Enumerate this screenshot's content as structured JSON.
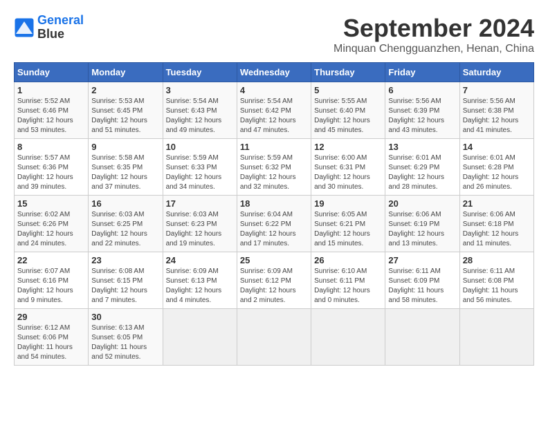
{
  "logo": {
    "line1": "General",
    "line2": "Blue"
  },
  "title": "September 2024",
  "location": "Minquan Chengguanzhen, Henan, China",
  "weekdays": [
    "Sunday",
    "Monday",
    "Tuesday",
    "Wednesday",
    "Thursday",
    "Friday",
    "Saturday"
  ],
  "weeks": [
    [
      {
        "day": "1",
        "sunrise": "5:52 AM",
        "sunset": "6:46 PM",
        "daylight": "12 hours and 53 minutes."
      },
      {
        "day": "2",
        "sunrise": "5:53 AM",
        "sunset": "6:45 PM",
        "daylight": "12 hours and 51 minutes."
      },
      {
        "day": "3",
        "sunrise": "5:54 AM",
        "sunset": "6:43 PM",
        "daylight": "12 hours and 49 minutes."
      },
      {
        "day": "4",
        "sunrise": "5:54 AM",
        "sunset": "6:42 PM",
        "daylight": "12 hours and 47 minutes."
      },
      {
        "day": "5",
        "sunrise": "5:55 AM",
        "sunset": "6:40 PM",
        "daylight": "12 hours and 45 minutes."
      },
      {
        "day": "6",
        "sunrise": "5:56 AM",
        "sunset": "6:39 PM",
        "daylight": "12 hours and 43 minutes."
      },
      {
        "day": "7",
        "sunrise": "5:56 AM",
        "sunset": "6:38 PM",
        "daylight": "12 hours and 41 minutes."
      }
    ],
    [
      {
        "day": "8",
        "sunrise": "5:57 AM",
        "sunset": "6:36 PM",
        "daylight": "12 hours and 39 minutes."
      },
      {
        "day": "9",
        "sunrise": "5:58 AM",
        "sunset": "6:35 PM",
        "daylight": "12 hours and 37 minutes."
      },
      {
        "day": "10",
        "sunrise": "5:59 AM",
        "sunset": "6:33 PM",
        "daylight": "12 hours and 34 minutes."
      },
      {
        "day": "11",
        "sunrise": "5:59 AM",
        "sunset": "6:32 PM",
        "daylight": "12 hours and 32 minutes."
      },
      {
        "day": "12",
        "sunrise": "6:00 AM",
        "sunset": "6:31 PM",
        "daylight": "12 hours and 30 minutes."
      },
      {
        "day": "13",
        "sunrise": "6:01 AM",
        "sunset": "6:29 PM",
        "daylight": "12 hours and 28 minutes."
      },
      {
        "day": "14",
        "sunrise": "6:01 AM",
        "sunset": "6:28 PM",
        "daylight": "12 hours and 26 minutes."
      }
    ],
    [
      {
        "day": "15",
        "sunrise": "6:02 AM",
        "sunset": "6:26 PM",
        "daylight": "12 hours and 24 minutes."
      },
      {
        "day": "16",
        "sunrise": "6:03 AM",
        "sunset": "6:25 PM",
        "daylight": "12 hours and 22 minutes."
      },
      {
        "day": "17",
        "sunrise": "6:03 AM",
        "sunset": "6:23 PM",
        "daylight": "12 hours and 19 minutes."
      },
      {
        "day": "18",
        "sunrise": "6:04 AM",
        "sunset": "6:22 PM",
        "daylight": "12 hours and 17 minutes."
      },
      {
        "day": "19",
        "sunrise": "6:05 AM",
        "sunset": "6:21 PM",
        "daylight": "12 hours and 15 minutes."
      },
      {
        "day": "20",
        "sunrise": "6:06 AM",
        "sunset": "6:19 PM",
        "daylight": "12 hours and 13 minutes."
      },
      {
        "day": "21",
        "sunrise": "6:06 AM",
        "sunset": "6:18 PM",
        "daylight": "12 hours and 11 minutes."
      }
    ],
    [
      {
        "day": "22",
        "sunrise": "6:07 AM",
        "sunset": "6:16 PM",
        "daylight": "12 hours and 9 minutes."
      },
      {
        "day": "23",
        "sunrise": "6:08 AM",
        "sunset": "6:15 PM",
        "daylight": "12 hours and 7 minutes."
      },
      {
        "day": "24",
        "sunrise": "6:09 AM",
        "sunset": "6:13 PM",
        "daylight": "12 hours and 4 minutes."
      },
      {
        "day": "25",
        "sunrise": "6:09 AM",
        "sunset": "6:12 PM",
        "daylight": "12 hours and 2 minutes."
      },
      {
        "day": "26",
        "sunrise": "6:10 AM",
        "sunset": "6:11 PM",
        "daylight": "12 hours and 0 minutes."
      },
      {
        "day": "27",
        "sunrise": "6:11 AM",
        "sunset": "6:09 PM",
        "daylight": "11 hours and 58 minutes."
      },
      {
        "day": "28",
        "sunrise": "6:11 AM",
        "sunset": "6:08 PM",
        "daylight": "11 hours and 56 minutes."
      }
    ],
    [
      {
        "day": "29",
        "sunrise": "6:12 AM",
        "sunset": "6:06 PM",
        "daylight": "11 hours and 54 minutes."
      },
      {
        "day": "30",
        "sunrise": "6:13 AM",
        "sunset": "6:05 PM",
        "daylight": "11 hours and 52 minutes."
      },
      null,
      null,
      null,
      null,
      null
    ]
  ]
}
